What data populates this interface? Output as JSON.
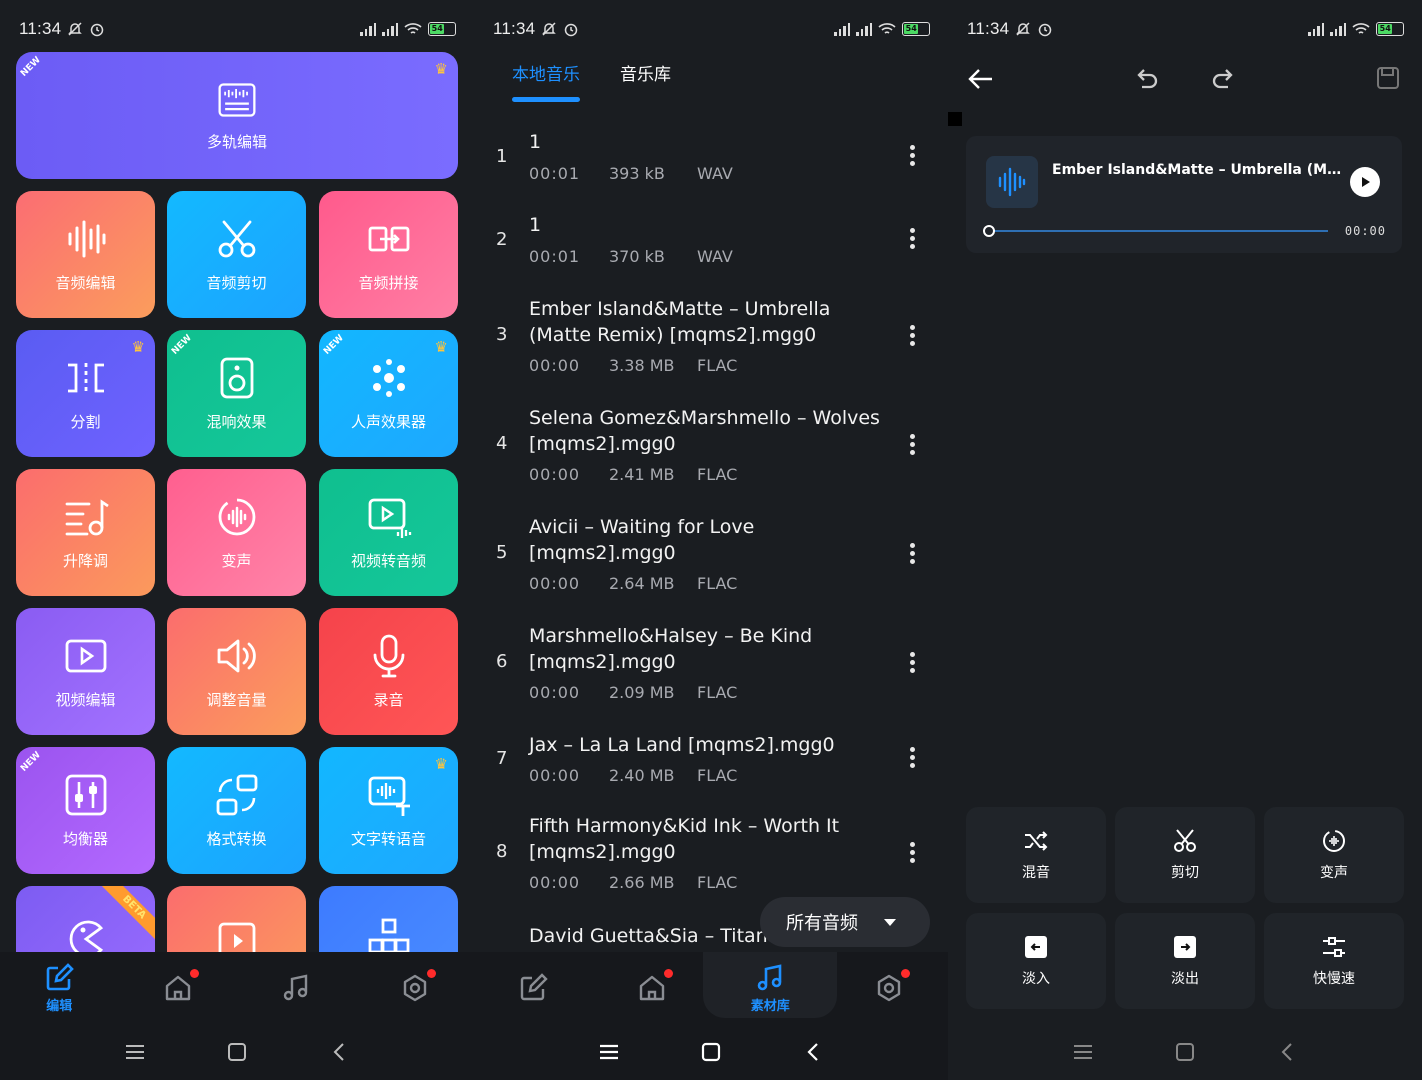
{
  "status": {
    "time": "11:34",
    "battery": "54"
  },
  "phone1": {
    "tiles": [
      {
        "label": "多轨编辑",
        "badge": "NEW"
      },
      {
        "label": "音频编辑"
      },
      {
        "label": "音频剪切"
      },
      {
        "label": "音频拼接"
      },
      {
        "label": "分割"
      },
      {
        "label": "混响效果",
        "badge": "NEW"
      },
      {
        "label": "人声效果器",
        "badge": "NEW"
      },
      {
        "label": "升降调"
      },
      {
        "label": "变声"
      },
      {
        "label": "视频转音频"
      },
      {
        "label": "视频编辑"
      },
      {
        "label": "调整音量"
      },
      {
        "label": "录音"
      },
      {
        "label": "均衡器",
        "badge": "NEW"
      },
      {
        "label": "格式转换"
      },
      {
        "label": "文字转语音"
      }
    ],
    "beta_badge": "BETA",
    "nav_active_label": "编辑"
  },
  "phone2": {
    "tabs": [
      "本地音乐",
      "音乐库"
    ],
    "rows": [
      {
        "n": "1",
        "title": "1",
        "dur": "00:01",
        "size": "393 kB",
        "fmt": "WAV"
      },
      {
        "n": "2",
        "title": "1",
        "dur": "00:01",
        "size": "370 kB",
        "fmt": "WAV"
      },
      {
        "n": "3",
        "title": "Ember Island&Matte – Umbrella (Matte Remix) [mqms2].mgg0",
        "dur": "00:00",
        "size": "3.38 MB",
        "fmt": "FLAC"
      },
      {
        "n": "4",
        "title": "Selena Gomez&Marshmello – Wolves [mqms2].mgg0",
        "dur": "00:00",
        "size": "2.41 MB",
        "fmt": "FLAC"
      },
      {
        "n": "5",
        "title": "Avicii – Waiting for Love [mqms2].mgg0",
        "dur": "00:00",
        "size": "2.64 MB",
        "fmt": "FLAC"
      },
      {
        "n": "6",
        "title": "Marshmello&Halsey – Be Kind [mqms2].mgg0",
        "dur": "00:00",
        "size": "2.09 MB",
        "fmt": "FLAC"
      },
      {
        "n": "7",
        "title": "Jax – La La Land [mqms2].mgg0",
        "dur": "00:00",
        "size": "2.40 MB",
        "fmt": "FLAC"
      },
      {
        "n": "8",
        "title": "Fifth Harmony&Kid Ink – Worth It [mqms2].mgg0",
        "dur": "00:00",
        "size": "2.66 MB",
        "fmt": "FLAC"
      },
      {
        "n": "",
        "title": "David Guetta&Sia – Titanium",
        "dur": "",
        "size": "",
        "fmt": ""
      }
    ],
    "filter_label": "所有音频",
    "nav_active_label": "素材库"
  },
  "phone3": {
    "player_title": "Ember Island&Matte – Umbrella (Ma...",
    "player_time": "00:00",
    "tools": [
      "混音",
      "剪切",
      "变声",
      "淡入",
      "淡出",
      "快慢速"
    ]
  },
  "colors": {
    "accent": "#1e90ff",
    "bg": "#1a1d21"
  }
}
